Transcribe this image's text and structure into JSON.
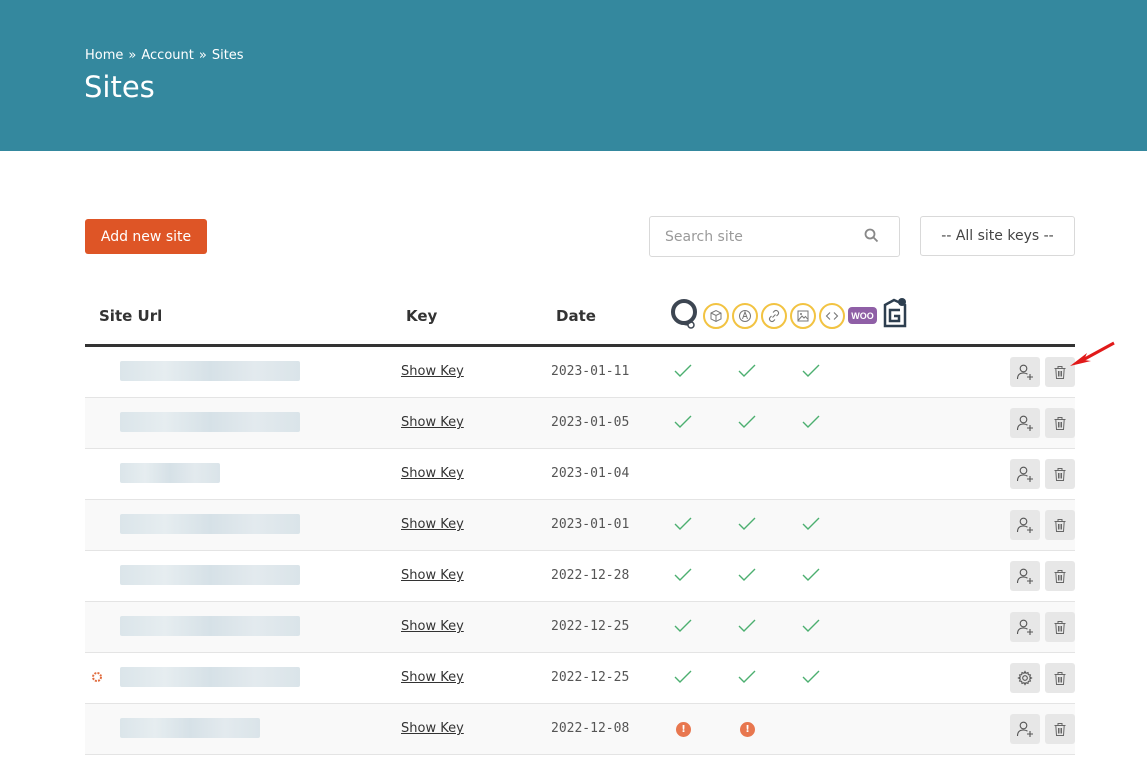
{
  "breadcrumb": {
    "home": "Home",
    "sep1": "»",
    "account": "Account",
    "sep2": "»",
    "sites": "Sites"
  },
  "page": {
    "title": "Sites"
  },
  "toolbar": {
    "add_label": "Add new site"
  },
  "search": {
    "placeholder": "Search site"
  },
  "filter": {
    "selected": "-- All site keys --"
  },
  "table": {
    "headers": {
      "site_url": "Site Url",
      "key": "Key",
      "date": "Date"
    },
    "feature_icons": [
      "headset-icon",
      "box-icon",
      "pen-icon",
      "link-icon",
      "image-icon",
      "code-icon",
      "woo-icon",
      "g-logo-icon"
    ],
    "woo_text": "WOO",
    "rows": [
      {
        "key_label": "Show Key",
        "date": "2023-01-11",
        "status": [
          "check",
          "check",
          "check"
        ],
        "action": "add-user"
      },
      {
        "key_label": "Show Key",
        "date": "2023-01-05",
        "status": [
          "check",
          "check",
          "check"
        ],
        "action": "add-user"
      },
      {
        "key_label": "Show Key",
        "date": "2023-01-04",
        "status": [],
        "action": "add-user"
      },
      {
        "key_label": "Show Key",
        "date": "2023-01-01",
        "status": [
          "check",
          "check",
          "check"
        ],
        "action": "add-user"
      },
      {
        "key_label": "Show Key",
        "date": "2022-12-28",
        "status": [
          "check",
          "check",
          "check"
        ],
        "action": "add-user"
      },
      {
        "key_label": "Show Key",
        "date": "2022-12-25",
        "status": [
          "check",
          "check",
          "check"
        ],
        "action": "add-user"
      },
      {
        "key_label": "Show Key",
        "date": "2022-12-25",
        "status": [
          "check",
          "check",
          "check"
        ],
        "action": "settings"
      },
      {
        "key_label": "Show Key",
        "date": "2022-12-08",
        "status": [
          "warn",
          "warn"
        ],
        "action": "add-user"
      }
    ]
  },
  "colors": {
    "header_bg": "#34889e",
    "accent": "#de5526",
    "check": "#4caf70",
    "warn": "#e8774f",
    "icon_ring": "#f2c342"
  }
}
